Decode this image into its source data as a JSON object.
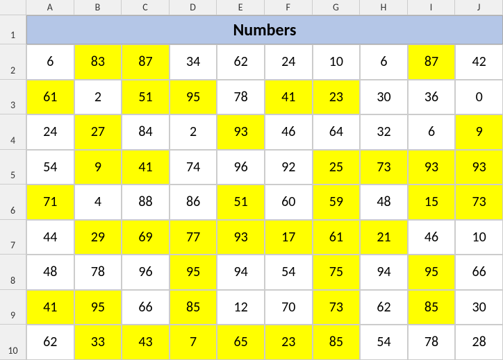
{
  "columns": [
    "A",
    "B",
    "C",
    "D",
    "E",
    "F",
    "G",
    "H",
    "I",
    "J"
  ],
  "title": "Numbers",
  "rowLabels": [
    "1",
    "2",
    "3",
    "4",
    "5",
    "6",
    "7",
    "8",
    "9",
    "10"
  ],
  "rows": [
    [
      {
        "v": 6,
        "h": false
      },
      {
        "v": 83,
        "h": true
      },
      {
        "v": 87,
        "h": true
      },
      {
        "v": 34,
        "h": false
      },
      {
        "v": 62,
        "h": false
      },
      {
        "v": 24,
        "h": false
      },
      {
        "v": 10,
        "h": false
      },
      {
        "v": 6,
        "h": false
      },
      {
        "v": 87,
        "h": true
      },
      {
        "v": 42,
        "h": false
      }
    ],
    [
      {
        "v": 61,
        "h": true
      },
      {
        "v": 2,
        "h": false
      },
      {
        "v": 51,
        "h": true
      },
      {
        "v": 95,
        "h": true
      },
      {
        "v": 78,
        "h": false
      },
      {
        "v": 41,
        "h": true
      },
      {
        "v": 23,
        "h": true
      },
      {
        "v": 30,
        "h": false
      },
      {
        "v": 36,
        "h": false
      },
      {
        "v": 0,
        "h": false
      }
    ],
    [
      {
        "v": 24,
        "h": false
      },
      {
        "v": 27,
        "h": true
      },
      {
        "v": 84,
        "h": false
      },
      {
        "v": 2,
        "h": false
      },
      {
        "v": 93,
        "h": true
      },
      {
        "v": 46,
        "h": false
      },
      {
        "v": 64,
        "h": false
      },
      {
        "v": 32,
        "h": false
      },
      {
        "v": 6,
        "h": false
      },
      {
        "v": 9,
        "h": true
      }
    ],
    [
      {
        "v": 54,
        "h": false
      },
      {
        "v": 9,
        "h": true
      },
      {
        "v": 41,
        "h": true
      },
      {
        "v": 74,
        "h": false
      },
      {
        "v": 96,
        "h": false
      },
      {
        "v": 92,
        "h": false
      },
      {
        "v": 25,
        "h": true
      },
      {
        "v": 73,
        "h": true
      },
      {
        "v": 93,
        "h": true
      },
      {
        "v": 93,
        "h": true
      }
    ],
    [
      {
        "v": 71,
        "h": true
      },
      {
        "v": 4,
        "h": false
      },
      {
        "v": 88,
        "h": false
      },
      {
        "v": 86,
        "h": false
      },
      {
        "v": 51,
        "h": true
      },
      {
        "v": 60,
        "h": false
      },
      {
        "v": 59,
        "h": true
      },
      {
        "v": 48,
        "h": false
      },
      {
        "v": 15,
        "h": true
      },
      {
        "v": 73,
        "h": true
      }
    ],
    [
      {
        "v": 44,
        "h": false
      },
      {
        "v": 29,
        "h": true
      },
      {
        "v": 69,
        "h": true
      },
      {
        "v": 77,
        "h": true
      },
      {
        "v": 93,
        "h": true
      },
      {
        "v": 17,
        "h": true
      },
      {
        "v": 61,
        "h": true
      },
      {
        "v": 21,
        "h": true
      },
      {
        "v": 46,
        "h": false
      },
      {
        "v": 10,
        "h": false
      }
    ],
    [
      {
        "v": 48,
        "h": false
      },
      {
        "v": 78,
        "h": false
      },
      {
        "v": 96,
        "h": false
      },
      {
        "v": 95,
        "h": true
      },
      {
        "v": 94,
        "h": false
      },
      {
        "v": 54,
        "h": false
      },
      {
        "v": 75,
        "h": true
      },
      {
        "v": 94,
        "h": false
      },
      {
        "v": 95,
        "h": true
      },
      {
        "v": 66,
        "h": false
      }
    ],
    [
      {
        "v": 41,
        "h": true
      },
      {
        "v": 95,
        "h": true
      },
      {
        "v": 66,
        "h": false
      },
      {
        "v": 85,
        "h": true
      },
      {
        "v": 12,
        "h": false
      },
      {
        "v": 70,
        "h": false
      },
      {
        "v": 73,
        "h": true
      },
      {
        "v": 62,
        "h": false
      },
      {
        "v": 85,
        "h": true
      },
      {
        "v": 30,
        "h": false
      }
    ],
    [
      {
        "v": 62,
        "h": false
      },
      {
        "v": 33,
        "h": true
      },
      {
        "v": 43,
        "h": true
      },
      {
        "v": 7,
        "h": true
      },
      {
        "v": 65,
        "h": true
      },
      {
        "v": 23,
        "h": true
      },
      {
        "v": 85,
        "h": true
      },
      {
        "v": 54,
        "h": false
      },
      {
        "v": 78,
        "h": false
      },
      {
        "v": 28,
        "h": false
      }
    ]
  ]
}
